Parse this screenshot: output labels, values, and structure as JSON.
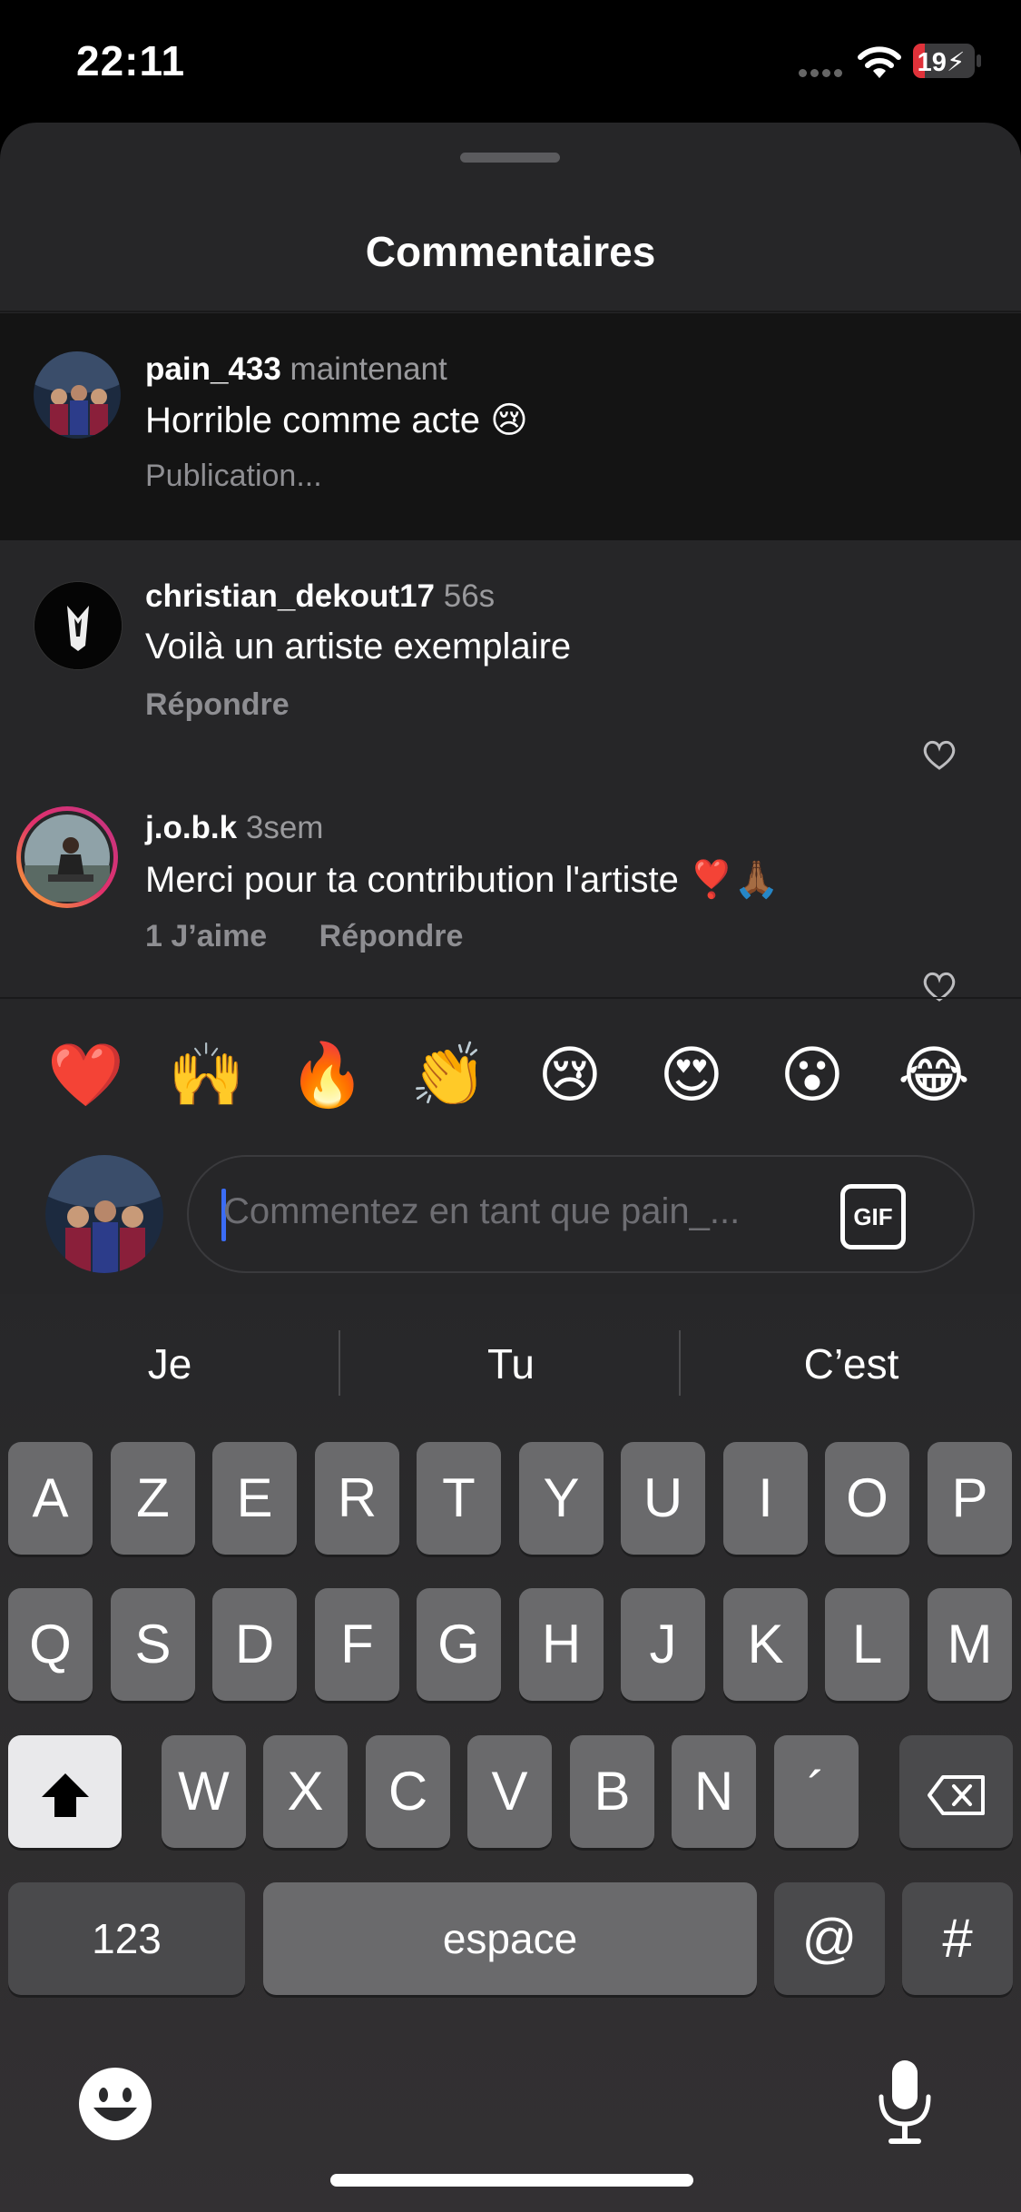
{
  "status": {
    "time": "22:11",
    "battery": "19"
  },
  "sheet": {
    "title": "Commentaires"
  },
  "comments": [
    {
      "user": "pain_433",
      "ago": "maintenant",
      "text": "Horrible comme acte 😢",
      "meta": "Publication..."
    },
    {
      "user": "christian_dekout17",
      "ago": "56s",
      "text": "Voilà un artiste exemplaire",
      "reply": "Répondre"
    },
    {
      "user": "j.o.b.k",
      "ago": "3sem",
      "text": "Merci pour ta contribution l'artiste ❣️🙏🏾",
      "likes": "1 J’aime",
      "reply": "Répondre"
    }
  ],
  "quick_reactions": [
    "❤️",
    "🙌",
    "🔥",
    "👏",
    "😢",
    "😍",
    "😮",
    "😂"
  ],
  "composer": {
    "placeholder": "Commentez en tant que pain_...",
    "gif_label": "GIF"
  },
  "keyboard": {
    "suggestions": [
      "Je",
      "Tu",
      "C’est"
    ],
    "row1": [
      "A",
      "Z",
      "E",
      "R",
      "T",
      "Y",
      "U",
      "I",
      "O",
      "P"
    ],
    "row2": [
      "Q",
      "S",
      "D",
      "F",
      "G",
      "H",
      "J",
      "K",
      "L",
      "M"
    ],
    "row3": [
      "W",
      "X",
      "C",
      "V",
      "B",
      "N",
      "´"
    ],
    "numbers_label": "123",
    "space_label": "espace",
    "at_label": "@",
    "hash_label": "#"
  },
  "colors": {
    "accent_caret": "#3b6cf6",
    "battery_red": "#e0323a"
  }
}
